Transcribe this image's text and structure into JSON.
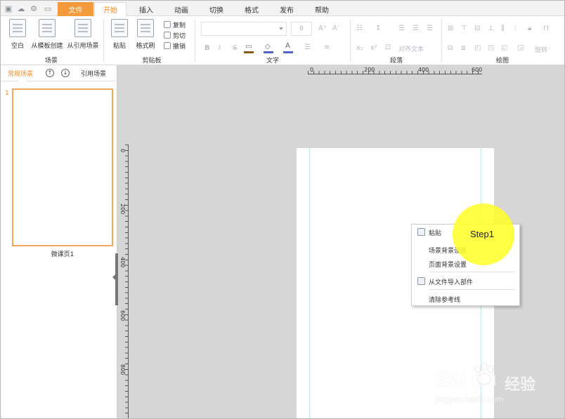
{
  "quick_access": [
    "save-icon",
    "cloud-icon",
    "settings-icon",
    "monitor-icon"
  ],
  "menu": {
    "file": "文件",
    "tabs": [
      "开始",
      "插入",
      "动画",
      "切换",
      "格式",
      "发布",
      "帮助"
    ],
    "active_tab": "开始"
  },
  "ribbon": {
    "scene": {
      "group_label": "场景",
      "buttons": [
        "空白",
        "从模板创建",
        "从引用场景"
      ]
    },
    "clipboard": {
      "group_label": "剪贴板",
      "big_buttons": [
        "粘贴",
        "格式刷"
      ],
      "small_buttons": [
        "复制",
        "剪切",
        "撤销"
      ]
    },
    "text": {
      "group_label": "文字",
      "font_size": "0",
      "style_buttons": [
        "B",
        "I",
        "S"
      ]
    },
    "paragraph": {
      "group_label": "段落",
      "align_text": "对齐文本"
    },
    "drawing": {
      "group_label": "绘图",
      "rotate": "旋转"
    }
  },
  "left_panel": {
    "tab_normal": "常规场景",
    "tab_ref": "引用场景",
    "slide_number": "1",
    "slide_label": "微课页1"
  },
  "ruler": {
    "h_labels": [
      "0",
      "200",
      "400",
      "600"
    ],
    "v_labels": [
      "0",
      "200",
      "400",
      "600",
      "800"
    ]
  },
  "context_menu": {
    "paste": "粘贴",
    "scene_bg": "场景背景设置",
    "page_bg": "页面背景设置",
    "import": "从文件导入部件",
    "clear_guides": "清除参考线"
  },
  "annotation": {
    "step": "Step1",
    "color": "#ffff24"
  },
  "watermark": {
    "logo": "Bai du",
    "brand": "经验",
    "url": "jingyan.baidu.com"
  },
  "colors": {
    "accent": "#f08a24",
    "file_menu": "#f59a3d"
  }
}
